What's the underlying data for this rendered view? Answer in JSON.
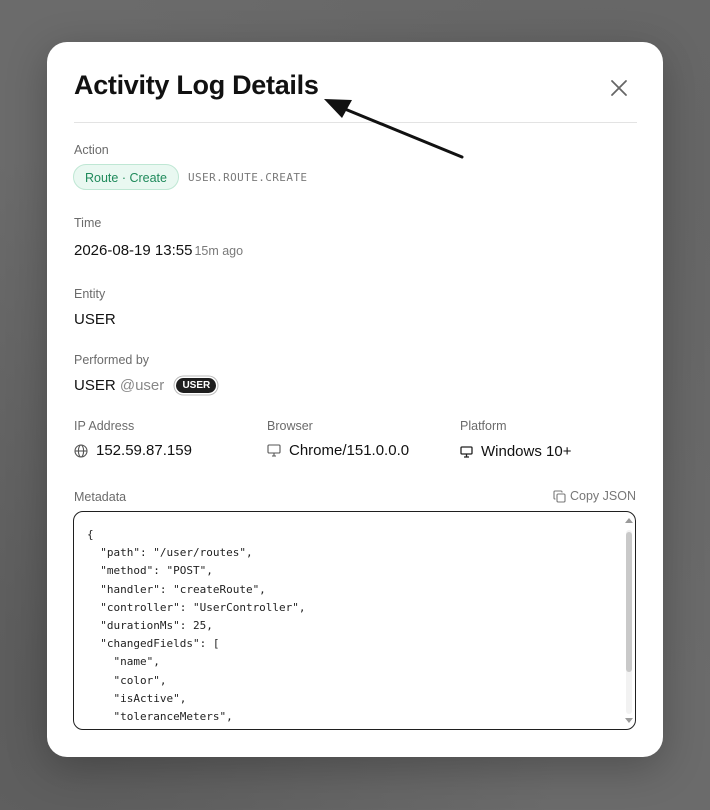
{
  "modal": {
    "title": "Activity Log Details",
    "close_label": "close"
  },
  "action": {
    "label": "Action",
    "badge": "Route · Create",
    "code": "USER.ROUTE.CREATE"
  },
  "time": {
    "label": "Time",
    "value": "2026-08-19 13:55",
    "relative": "15m ago"
  },
  "entity": {
    "label": "Entity",
    "value": "USER"
  },
  "performed_by": {
    "label": "Performed by",
    "name": "USER",
    "handle": "@user",
    "role_badge": "USER"
  },
  "ip": {
    "label": "IP Address",
    "value": "152.59.87.159",
    "icon": "globe-icon"
  },
  "browser": {
    "label": "Browser",
    "value": "Chrome/151.0.0.0",
    "icon": "monitor-icon"
  },
  "platform": {
    "label": "Platform",
    "value": "Windows 10+",
    "icon": "monitor-icon"
  },
  "metadata": {
    "label": "Metadata",
    "copy_label": "Copy JSON",
    "json_text": "{\n  \"path\": \"/user/routes\",\n  \"method\": \"POST\",\n  \"handler\": \"createRoute\",\n  \"controller\": \"UserController\",\n  \"durationMs\": 25,\n  \"changedFields\": [\n    \"name\",\n    \"color\",\n    \"isActive\",\n    \"toleranceMeters\",\n    \"polyline\""
  },
  "colors": {
    "accent_green": "#1f8a5b",
    "badge_green_bg": "#e9f8f1",
    "dark_badge": "#1e1e1e"
  }
}
